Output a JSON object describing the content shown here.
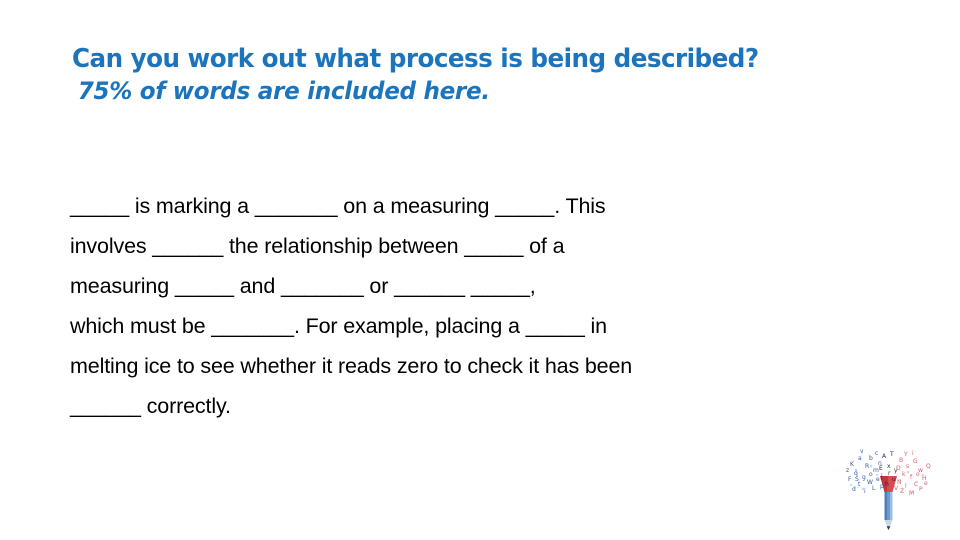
{
  "slide": {
    "background_color": "#ffffff",
    "heading": {
      "color": "#1C75BC",
      "line1": "Can you work out what process is being described?",
      "line2": "75% of words are included here."
    },
    "body": {
      "color": "#000000",
      "lines": [
        "_____ is marking a _______ on a measuring _____. This",
        "involves ______ the relationship between _____ of a",
        "measuring _____ and _______ or ______ _____,",
        "which must be _______. For example, placing a _____ in",
        "melting ice to see whether it reads zero to check it has been",
        "______ correctly."
      ],
      "full_text": "_____ is marking a _______ on a measuring _____. This involves ______ the relationship between _____ of a measuring _____ and _______ or ______ _____, which must be _______. For example, placing a _____ in melting ice to see whether it reads zero to check it has been ______ correctly."
    },
    "logo": {
      "name": "pencil-with-letters-logo",
      "pencil_body_color": "#6C9BD2",
      "pencil_tip_color": "#D94A52",
      "letters_left_color": "#2B5EA8",
      "letters_right_color": "#D4616B"
    }
  }
}
